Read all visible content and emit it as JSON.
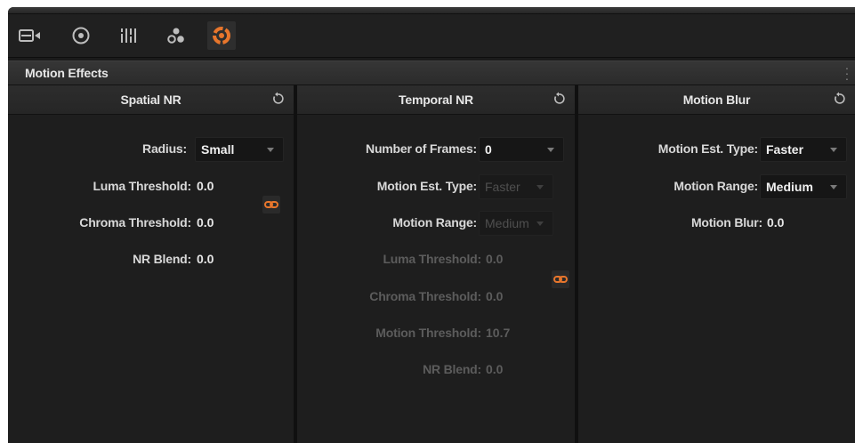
{
  "toolbar": {
    "icons": [
      "camera-icon",
      "target-circle-icon",
      "bars-icon",
      "dots-cluster-icon",
      "motion-effects-icon"
    ],
    "active_index": 4
  },
  "panel": {
    "title": "Motion Effects"
  },
  "spatial_nr": {
    "title": "Spatial NR",
    "radius_label": "Radius:",
    "radius_value": "Small",
    "luma_threshold_label": "Luma Threshold:",
    "luma_threshold_value": "0.0",
    "chroma_threshold_label": "Chroma Threshold:",
    "chroma_threshold_value": "0.0",
    "nr_blend_label": "NR Blend:",
    "nr_blend_value": "0.0"
  },
  "temporal_nr": {
    "title": "Temporal NR",
    "frames_label": "Number of Frames:",
    "frames_value": "0",
    "motion_est_label": "Motion Est. Type:",
    "motion_est_value": "Faster",
    "motion_range_label": "Motion Range:",
    "motion_range_value": "Medium",
    "luma_threshold_label": "Luma Threshold:",
    "luma_threshold_value": "0.0",
    "chroma_threshold_label": "Chroma Threshold:",
    "chroma_threshold_value": "0.0",
    "motion_threshold_label": "Motion Threshold:",
    "motion_threshold_value": "10.7",
    "nr_blend_label": "NR Blend:",
    "nr_blend_value": "0.0"
  },
  "motion_blur": {
    "title": "Motion Blur",
    "motion_est_label": "Motion Est. Type:",
    "motion_est_value": "Faster",
    "motion_range_label": "Motion Range:",
    "motion_range_value": "Medium",
    "motion_blur_label": "Motion Blur:",
    "motion_blur_value": "0.0"
  },
  "colors": {
    "background": "#1e1e1e",
    "accent": "#e8762c",
    "text": "#e6e6e6",
    "disabled_text": "#5c5c5c"
  }
}
